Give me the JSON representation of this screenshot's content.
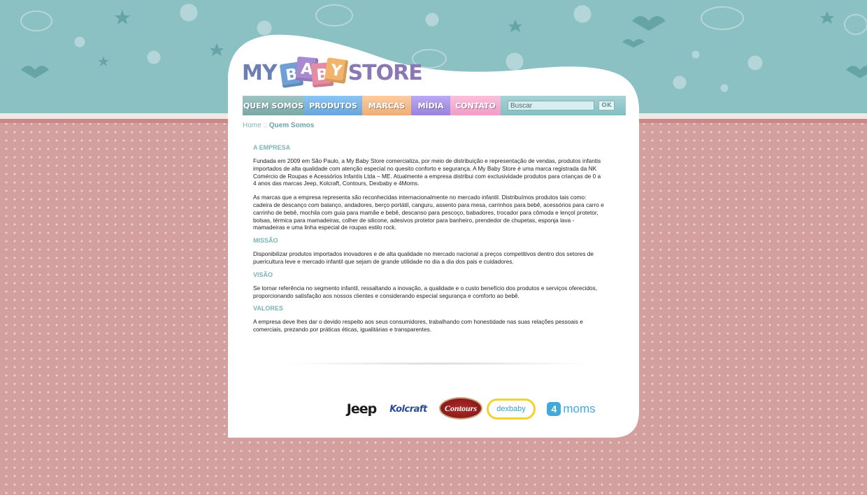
{
  "header": {
    "logo": {
      "my": "MY",
      "baby_letters": [
        "B",
        "A",
        "B",
        "Y"
      ],
      "store": "STORE"
    },
    "colors": {
      "sky": "#8cc1c3",
      "pattern": "#d4a09f",
      "cube_blue": "#6f9fd6",
      "cube_purple": "#a88ad1",
      "cube_pink": "#e68ba6",
      "cube_orange": "#f2b36b"
    }
  },
  "nav": {
    "items": [
      {
        "label": "QUEM SOMOS",
        "color": "#8bb3b2"
      },
      {
        "label": "PRODUTOS",
        "color": "#7ab6e8"
      },
      {
        "label": "MARCAS",
        "color": "#f5bc8a"
      },
      {
        "label": "MÍDIA",
        "color": "#a996e6"
      },
      {
        "label": "CONTATO",
        "color": "#f5a9cf"
      }
    ],
    "search": {
      "placeholder": "Buscar",
      "button": "OK"
    }
  },
  "breadcrumb": {
    "home": "Home",
    "separator": "::",
    "current": "Quem Somos"
  },
  "content": {
    "sections": [
      {
        "heading": "A EMPRESA",
        "paragraphs": [
          "Fundada em 2009 em São Paulo, a My Baby Store comercializa, por meio de distribuição e representação de vendas, produtos infantis importados de alta qualidade com atenção especial no quesito conforto e segurança. A My Baby Store é uma marca registrada da NK Comércio de Roupas e Acessórios Infantis Ltda – ME. Atualmente a empresa distribui com exclusividade produtos para crianças de 0 a 4 anos das marcas Jeep, Kolcraft, Contours, Dexbaby e 4Moms.",
          "As marcas que a empresa representa são reconhecidas internacionalmente no mercado infantil. Distribuímos produtos tais como: cadeira de descanço com balanço, andadores, berço portátil, canguru, assento para mesa, carrinhos para bebê, acessórios para carro e carrinho de bebê, mochila com guia para mamãe e bebê, descanso para pescoço, babadores, trocador para cômoda e lençol protetor, bolsas, térmica para mamadeiras, colher de silicone, adesivos protetor para banheiro, prendedor de chupetas, esponja lava - mamadeiras e uma linha especial de roupas estilo rock."
        ]
      },
      {
        "heading": "MISSÃO",
        "paragraphs": [
          "Disponibilizar produtos importados inovadores e de alta qualidade no mercado nacional a preços competitivos dentro dos setores de puericultura leve e mercado infantil que sejam de grande utilidade no dia a dia dos pais e cuidadores."
        ]
      },
      {
        "heading": "VISÃO",
        "paragraphs": [
          "Se tornar referência no segmento infantil, ressaltando a inovação, a qualidade e o custo benefício dos produtos e serviços oferecidos, proporcionando satisfação aos nossos clientes e considerando especial segurança e comforto ao bebê."
        ]
      },
      {
        "heading": "VALORES",
        "paragraphs": [
          "A empresa deve lhes dar o devido respeito aos seus consumidores, trabalhando com honestidade nas suas relações pessoais e comerciais, prezando por práticas éticas, igualitárias e transparentes."
        ]
      }
    ]
  },
  "brands": {
    "jeep": "Jeep",
    "kolcraft": "Kolcraft",
    "contours": "Contours",
    "dexbaby": "dexbaby",
    "fourmoms_num": "4",
    "fourmoms_word": "moms"
  }
}
